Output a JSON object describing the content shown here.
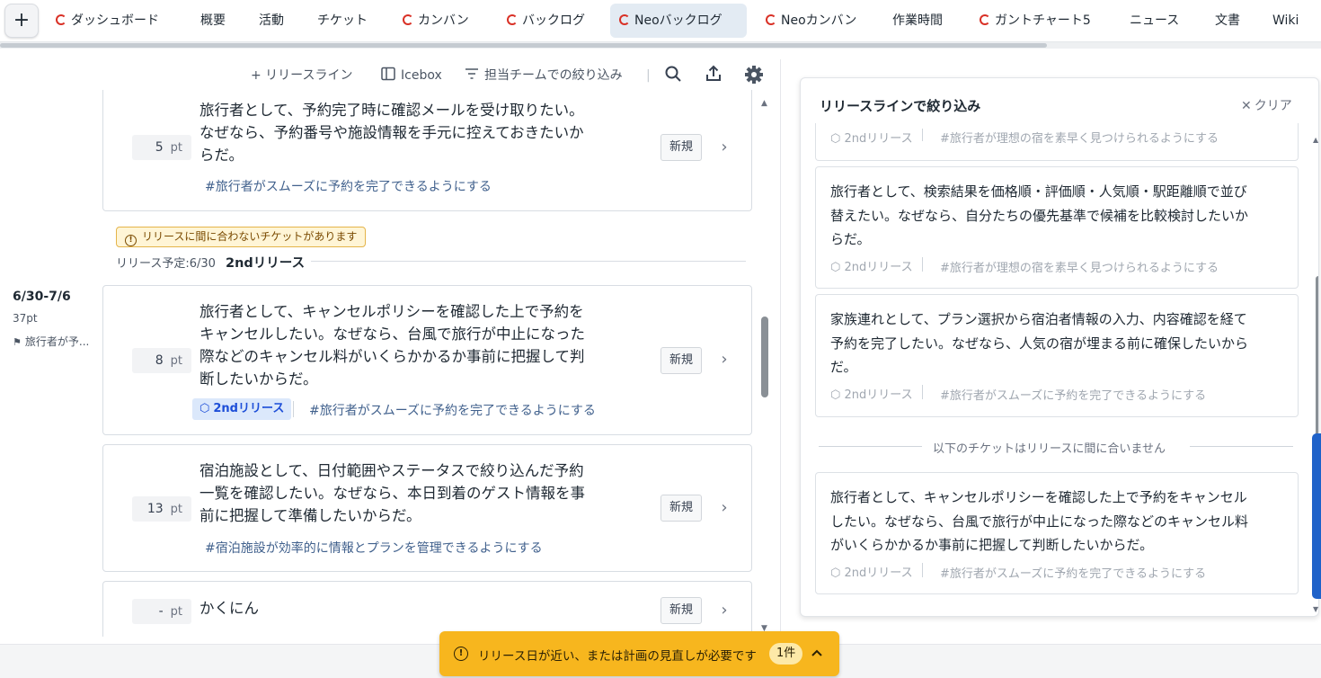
{
  "nav": {
    "add_label": "+",
    "tabs": [
      {
        "label": "ダッシュボード",
        "logo": true
      },
      {
        "label": "概要",
        "logo": false
      },
      {
        "label": "活動",
        "logo": false
      },
      {
        "label": "チケット",
        "logo": false
      },
      {
        "label": "カンバン",
        "logo": true
      },
      {
        "label": "バックログ",
        "logo": true
      },
      {
        "label": "Neoバックログ",
        "logo": true,
        "active": true
      },
      {
        "label": "Neoカンバン",
        "logo": true
      },
      {
        "label": "作業時間",
        "logo": false
      },
      {
        "label": "ガントチャート5",
        "logo": true
      },
      {
        "label": "ニュース",
        "logo": false
      },
      {
        "label": "文書",
        "logo": false
      },
      {
        "label": "Wiki",
        "logo": false
      }
    ]
  },
  "toolbar": {
    "release_line": "+ リリースライン",
    "icebox": "Icebox",
    "team_filter": "担当チームでの絞り込み",
    "separator": "|"
  },
  "backlog": {
    "cards": [
      {
        "points": "5",
        "unit": "pt",
        "lines": [
          "旅行者として、予約完了時に確認メールを受け取りたい。",
          "なぜなら、予約番号や施設情報を手元に控えておきたいか",
          "らだ。"
        ],
        "tag": "#旅行者がスムーズに予約を完了できるようにする",
        "status": "新規"
      },
      {
        "points": "8",
        "unit": "pt",
        "lines": [
          "旅行者として、キャンセルポリシーを確認した上で予約を",
          "キャンセルしたい。なぜなら、台風で旅行が中止になった",
          "際などのキャンセル料がいくらかかるか事前に把握して判",
          "断したいからだ。"
        ],
        "release": "2ndリリース",
        "tag": "#旅行者がスムーズに予約を完了できるようにする",
        "status": "新規"
      },
      {
        "points": "13",
        "unit": "pt",
        "lines": [
          "宿泊施設として、日付範囲やステータスで絞り込んだ予約",
          "一覧を確認したい。なぜなら、本日到着のゲスト情報を事",
          "前に把握して準備したいからだ。"
        ],
        "tag": "#宿泊施設が効率的に情報とプランを管理できるようにする",
        "status": "新規"
      },
      {
        "points": "-",
        "unit": "pt",
        "lines": [
          "かくにん"
        ],
        "status": "新規"
      }
    ],
    "warning": "リリースに間に合わないチケットがあります",
    "release_due": "リリース予定:6/30",
    "release_name": "2ndリリース",
    "sprint": {
      "dates": "6/30-7/6",
      "points": "37pt",
      "goal": "旅行者が予..."
    }
  },
  "panel": {
    "title": "リリースラインで絞り込み",
    "clear": "クリア",
    "partial_meta": {
      "release": "2ndリリース",
      "tag": "#旅行者が理想の宿を素早く見つけられるようにする"
    },
    "cards": [
      {
        "lines": [
          "旅行者として、検索結果を価格順・評価順・人気順・駅距離順で並び",
          "替えたい。なぜなら、自分たちの優先基準で候補を比較検討したいか",
          "らだ。"
        ],
        "release": "2ndリリース",
        "tag": "#旅行者が理想の宿を素早く見つけられるようにする"
      },
      {
        "lines": [
          "家族連れとして、プラン選択から宿泊者情報の入力、内容確認を経て",
          "予約を完了したい。なぜなら、人気の宿が埋まる前に確保したいから",
          "だ。"
        ],
        "release": "2ndリリース",
        "tag": "#旅行者がスムーズに予約を完了できるようにする"
      }
    ],
    "divider": "以下のチケットはリリースに間に合いません",
    "late_card": {
      "lines": [
        "旅行者として、キャンセルポリシーを確認した上で予約をキャンセル",
        "したい。なぜなら、台風で旅行が中止になった際などのキャンセル料",
        "がいくらかかるか事前に把握して判断したいからだ。"
      ],
      "release": "2ndリリース",
      "tag": "#旅行者がスムーズに予約を完了できるようにする"
    }
  },
  "notification": {
    "text": "リリース日が近い、または計画の見直しが必要です",
    "count": "1件"
  }
}
